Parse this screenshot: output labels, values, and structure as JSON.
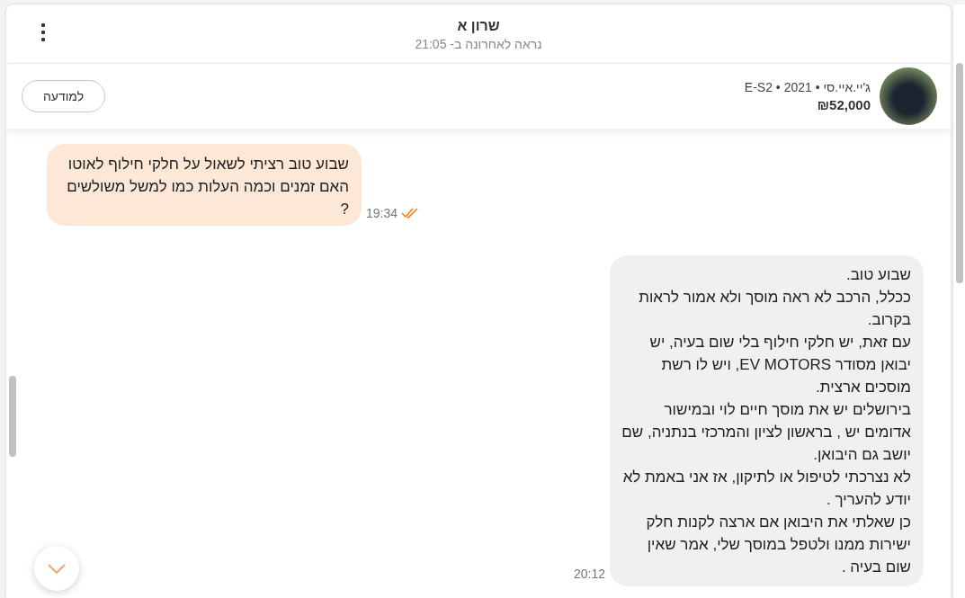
{
  "header": {
    "name": "שרון א",
    "last_seen": "נראה לאחרונה ב- 21:05"
  },
  "listing": {
    "title": "ג'יי.איי.סי • 2021 • E-S2",
    "price": "₪52,000",
    "button": "למודעה"
  },
  "messages": [
    {
      "kind": "outgoing",
      "text": "שבוע טוב רציתי לשאול על חלקי חילוף לאוטו האם זמנים וכמה העלות כמו למשל משולשים ?",
      "time": "19:34",
      "read": true
    },
    {
      "kind": "incoming",
      "text": "שבוע טוב.\nככלל, הרכב לא ראה מוסך ולא אמור לראות בקרוב.\nעם זאת, יש חלקי חילוף בלי שום בעיה, יש יבואן מסודר EV MOTORS, ויש לו רשת מוסכים ארצית.\nבירושלים יש את מוסך חיים לוי ובמישור אדומים יש , בראשון לציון והמרכזי בנתניה, שם יושב גם היבואן.\nלא נצרכתי לטיפול או לתיקון, אז אני באמת לא יודע להעריך .\nכן שאלתי את היבואן אם ארצה לקנות חלק ישירות ממנו ולטפל במוסך שלי, אמר שאין שום בעיה .",
      "time": "20:12"
    }
  ]
}
